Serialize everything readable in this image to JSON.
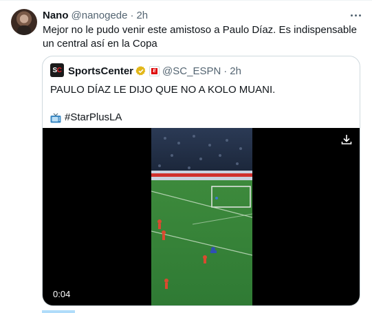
{
  "tweet": {
    "author_name": "Nano",
    "handle": "@nanogede",
    "separator": "·",
    "time": "2h",
    "text": "Mejor no le pudo venir este amistoso a Paulo Díaz. Es indispensable un central así en la Copa",
    "more_icon": "more-icon"
  },
  "quote": {
    "avatar_text_main": "S",
    "avatar_text_accent": "C",
    "author_name": "SportsCenter",
    "handle": "@SC_ESPN",
    "separator": "·",
    "time": "2h",
    "text": "PAULO DÍAZ LE DIJO QUE NO A KOLO MUANI.",
    "hashtag": "#StarPlusLA",
    "badge_letter": "E",
    "video": {
      "timestamp": "0:04"
    }
  },
  "colors": {
    "text": "#0f1419",
    "muted": "#536471",
    "border": "#cfd9de",
    "accent": "#1d9bf0",
    "verified": "#e2b719"
  }
}
